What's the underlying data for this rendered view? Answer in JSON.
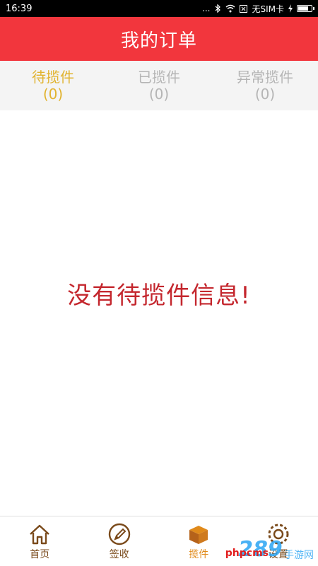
{
  "status_bar": {
    "time": "16:39",
    "dots": "...",
    "sim_text": "无SIM卡",
    "bluetooth_icon": "bluetooth-icon",
    "wifi_icon": "wifi-icon",
    "battery_icon": "battery-icon"
  },
  "header": {
    "title": "我的订单"
  },
  "tabs": [
    {
      "label": "待揽件",
      "count": "(0)"
    },
    {
      "label": "已揽件",
      "count": "(0)"
    },
    {
      "label": "异常揽件",
      "count": "(0)"
    }
  ],
  "empty_message": "没有待揽件信息!",
  "bottom_nav": [
    {
      "label": "首页",
      "icon": "home-icon"
    },
    {
      "label": "签收",
      "icon": "pen-icon"
    },
    {
      "label": "揽件",
      "icon": "package-icon"
    },
    {
      "label": "设置",
      "icon": "gear-icon"
    }
  ],
  "watermark": {
    "logo": "289",
    "site": "手游网",
    "text": "phpcms"
  },
  "colors": {
    "header_bg": "#f2363d",
    "tab_active": "#e1b32f",
    "tab_inactive": "#b5b5b5",
    "empty_text": "#c4272e",
    "nav_icon": "#7a4a1b",
    "nav_active": "#e08a1a"
  }
}
